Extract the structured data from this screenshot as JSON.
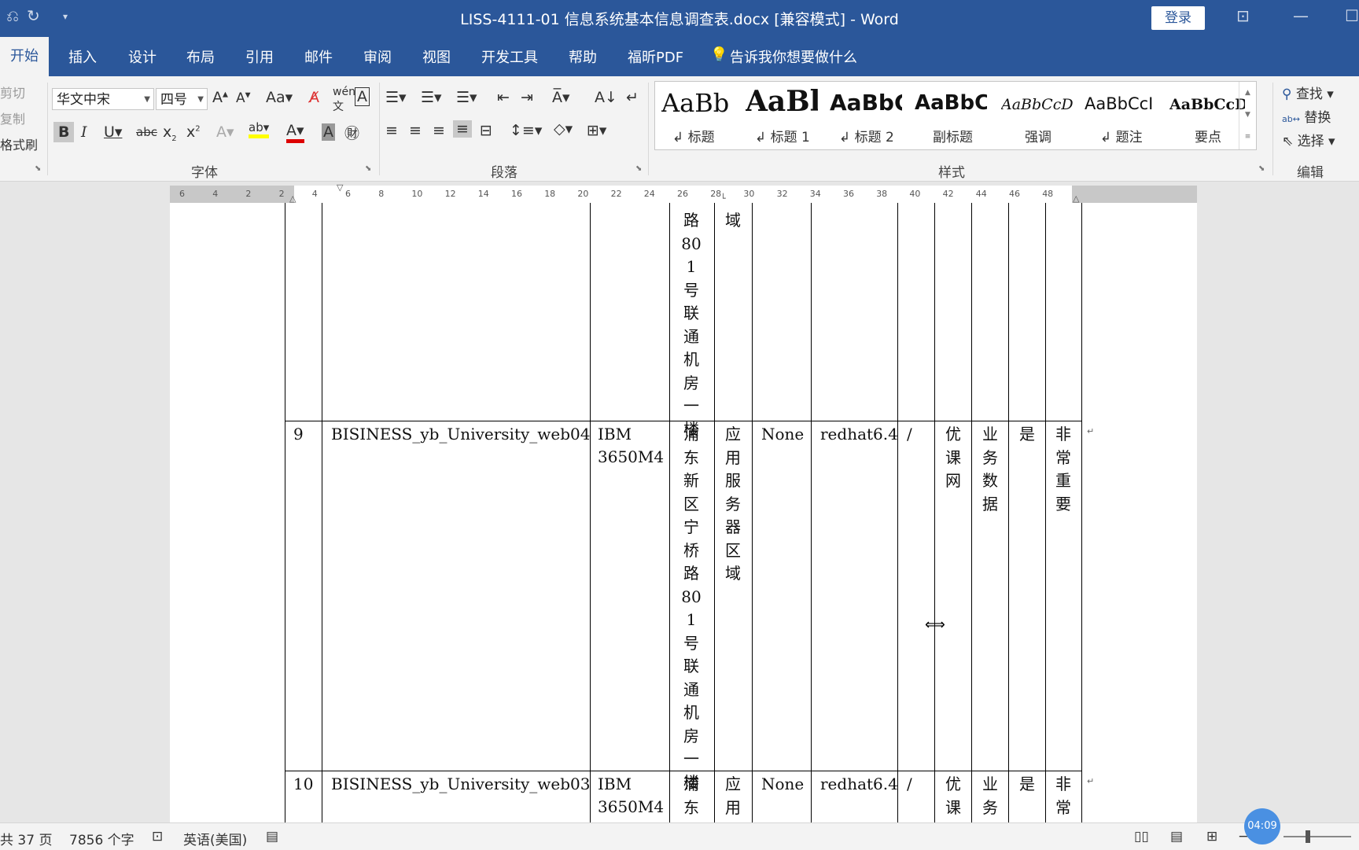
{
  "window": {
    "title": "LISS-4111-01 信息系统基本信息调查表.docx [兼容模式]  -  Word",
    "login": "登录"
  },
  "tabs": [
    "开始",
    "插入",
    "设计",
    "布局",
    "引用",
    "邮件",
    "审阅",
    "视图",
    "开发工具",
    "帮助",
    "福昕PDF"
  ],
  "tell_me": "告诉我你想要做什么",
  "clipboard": {
    "cut": "剪切",
    "copy": "复制",
    "format_painter": "格式刷"
  },
  "font": {
    "name": "华文中宋",
    "size": "四号",
    "group_label": "字体"
  },
  "paragraph": {
    "group_label": "段落"
  },
  "styles": {
    "group_label": "样式",
    "items": [
      {
        "sample": "AaBb",
        "name": "标题"
      },
      {
        "sample": "AaBl",
        "name": "标题 1"
      },
      {
        "sample": "AaBbC",
        "name": "标题 2"
      },
      {
        "sample": "AaBbC",
        "name": "副标题"
      },
      {
        "sample": "AaBbCcDc",
        "name": "强调"
      },
      {
        "sample": "AaBbCcI",
        "name": "题注"
      },
      {
        "sample": "AaBbCcD",
        "name": "要点"
      }
    ]
  },
  "editing": {
    "find": "查找",
    "replace": "替换",
    "select": "选择",
    "group_label": "编辑"
  },
  "ruler_labels": [
    "6",
    "4",
    "2",
    "2",
    "4",
    "6",
    "8",
    "10",
    "12",
    "14",
    "16",
    "18",
    "20",
    "22",
    "24",
    "26",
    "28",
    "30",
    "32",
    "34",
    "36",
    "38",
    "40",
    "42",
    "44",
    "46",
    "48"
  ],
  "table": {
    "top_fragment": {
      "location_tail": "路801号联通机房一楼",
      "area_tail": "域"
    },
    "rows": [
      {
        "num": "9",
        "name": "BISINESS_yb_University_web04",
        "model": "IBM 3650M4",
        "location": "浦东新区宁桥路801号联通机房一楼",
        "area": "应用服务器区域",
        "col6": "None",
        "os": "redhat6.4",
        "col8": "/",
        "network": "优课网",
        "data": "业务数据",
        "yes": "是",
        "importance": "非常重要"
      },
      {
        "num": "10",
        "name": "BISINESS_yb_University_web03",
        "model": "IBM 3650M4",
        "location": "浦东",
        "area": "应用",
        "col6": "None",
        "os": "redhat6.4",
        "col8": "/",
        "network": "优课",
        "data": "业务",
        "yes": "是",
        "importance": "非常"
      }
    ]
  },
  "status": {
    "pages": "共 37 页",
    "words": "7856 个字",
    "language": "英语(美国)",
    "timer": "04:09"
  }
}
